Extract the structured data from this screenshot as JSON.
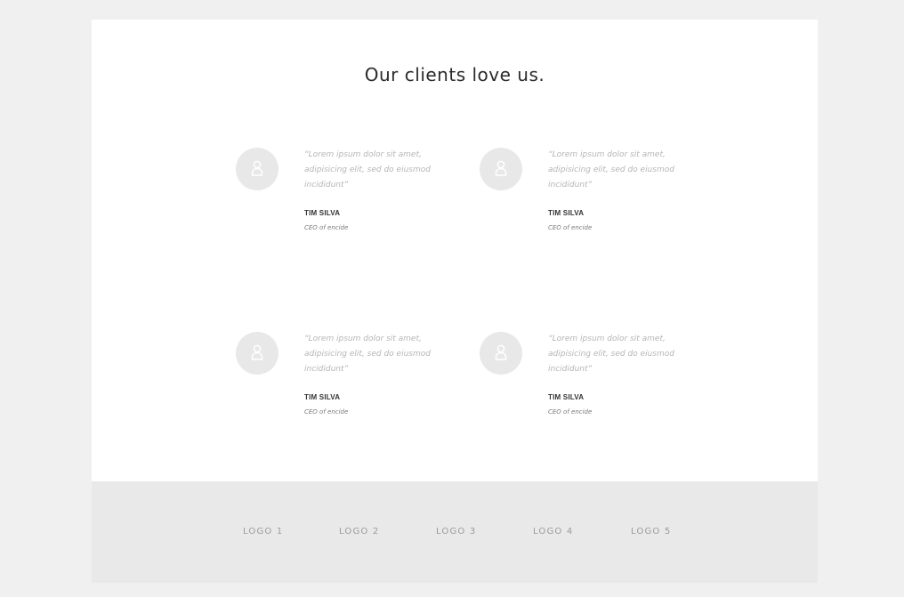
{
  "section": {
    "title": "Our clients love us."
  },
  "testimonials": [
    {
      "quote": "“Lorem ipsum dolor sit amet, adipisicing elit, sed do eiusmod incididunt”",
      "name": "TIM SILVA",
      "role": "CEO of encide",
      "icon": "user-icon"
    },
    {
      "quote": "“Lorem ipsum dolor sit amet, adipisicing elit, sed do eiusmod incididunt”",
      "name": "TIM SILVA",
      "role": "CEO of encide",
      "icon": "user-icon"
    },
    {
      "quote": "“Lorem ipsum dolor sit amet, adipisicing elit, sed do eiusmod incididunt”",
      "name": "TIM SILVA",
      "role": "CEO of encide",
      "icon": "user-icon"
    },
    {
      "quote": "“Lorem ipsum dolor sit amet, adipisicing elit, sed do eiusmod incididunt”",
      "name": "TIM SILVA",
      "role": "CEO of encide",
      "icon": "user-icon"
    }
  ],
  "logos": [
    "LOGO 1",
    "LOGO 2",
    "LOGO 3",
    "LOGO 4",
    "LOGO 5"
  ],
  "colors": {
    "page_background": "#f0f0f0",
    "card_background": "#ffffff",
    "logo_band_background": "#e9e9e9",
    "avatar_background": "#e8e8e8",
    "quote_text": "#b5b5b5",
    "title_text": "#2b2b2b"
  }
}
